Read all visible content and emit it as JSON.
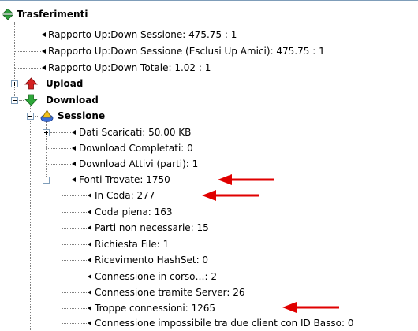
{
  "tree": {
    "root": {
      "label": "Trasferimenti",
      "icon": "up-down-arrows-icon"
    },
    "root_children": [
      {
        "label": "Rapporto Up:Down Sessione: 475.75 : 1"
      },
      {
        "label": "Rapporto Up:Down Sessione (Esclusi Up Amici): 475.75 : 1"
      },
      {
        "label": "Rapporto Up:Down Totale: 1.02 : 1"
      }
    ],
    "upload": {
      "label": "Upload",
      "icon": "red-up-arrow-icon",
      "expanded": false
    },
    "download": {
      "label": "Download",
      "icon": "green-down-arrow-icon",
      "expanded": true
    },
    "sessione": {
      "label": "Sessione",
      "icon": "session-folder-icon",
      "expanded": true
    },
    "session_items": [
      {
        "label": "Dati Scaricati: 50.00 KB",
        "expandable": true,
        "expanded": false
      },
      {
        "label": "Download Completati: 0"
      },
      {
        "label": "Download Attivi (parti): 1"
      },
      {
        "label": "Fonti Trovate: 1750",
        "expandable": true,
        "expanded": true
      }
    ],
    "fonti_items": [
      {
        "label": "In Coda: 277"
      },
      {
        "label": "Coda piena: 163"
      },
      {
        "label": "Parti non necessarie: 15"
      },
      {
        "label": "Richiesta File: 1"
      },
      {
        "label": "Ricevimento HashSet: 0"
      },
      {
        "label": "Connessione in corso…: 2"
      },
      {
        "label": "Connessione tramite Server: 26"
      },
      {
        "label": "Troppe connessioni: 1265"
      },
      {
        "label": "Connessione impossibile tra due client con ID Basso: 0"
      }
    ]
  },
  "annotations": {
    "arrow_color": "#e00000",
    "highlighted": [
      "Fonti Trovate: 1750",
      "In Coda: 277",
      "Troppe connessioni: 1265"
    ]
  }
}
